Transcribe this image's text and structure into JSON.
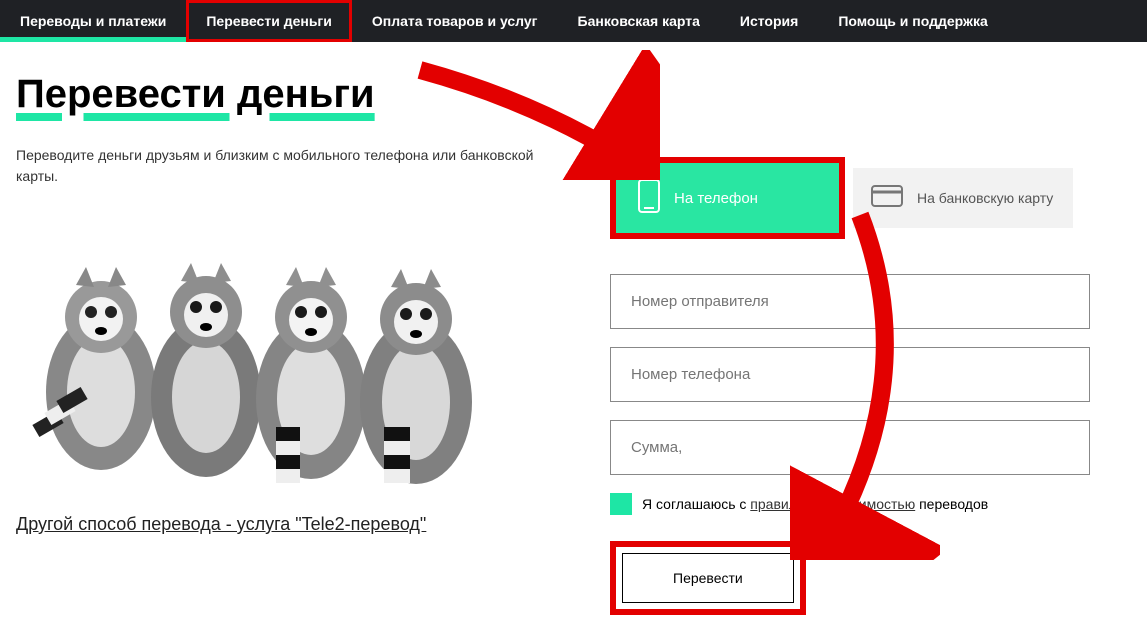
{
  "nav": {
    "items": [
      "Переводы и платежи",
      "Перевести деньги",
      "Оплата товаров и услуг",
      "Банковская карта",
      "История",
      "Помощь и поддержка"
    ]
  },
  "page": {
    "title": "Перевести деньги",
    "subtitle": "Переводите деньги друзьям и близким с мобильного телефона или банковской карты.",
    "alt_link": "Другой способ перевода - услуга \"Tele2-перевод\""
  },
  "tabs": {
    "phone": "На телефон",
    "card": "На банковскую карту"
  },
  "form": {
    "sender_placeholder": "Номер отправителя",
    "phone_placeholder": "Номер телефона",
    "amount_placeholder": "Сумма,",
    "consent_prefix": "Я соглашаюсь с ",
    "consent_rules": "правилами",
    "consent_and": " и ",
    "consent_cost": "стоимостью",
    "consent_suffix": " переводов",
    "submit": "Перевести"
  }
}
